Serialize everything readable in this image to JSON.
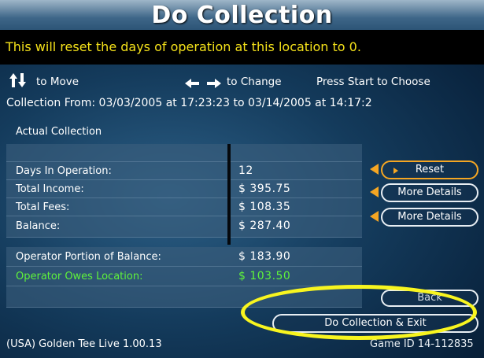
{
  "title": "Do Collection",
  "warning": "This will reset the days of operation at this location to 0.",
  "hints": {
    "move_icon": "up-down-arrows-icon",
    "move": "to Move",
    "change_icon": "left-right-arrows-icon",
    "change": "to Change",
    "choose": "Press Start to Choose"
  },
  "collection_range": "Collection From: 03/03/2005 at 17:23:23 to 03/14/2005 at 14:17:2",
  "section_label": "Actual Collection",
  "rows": [
    {
      "label": "Days In Operation:",
      "value": "12"
    },
    {
      "label": "Total Income:",
      "value": "$ 395.75"
    },
    {
      "label": "Total Fees:",
      "value": "$ 108.35"
    },
    {
      "label": "Balance:",
      "value": "$ 287.40"
    },
    {
      "label": "Operator Portion of Balance:",
      "value": "$ 183.90"
    },
    {
      "label": "Operator Owes Location:",
      "value": "$ 103.50"
    }
  ],
  "buttons": {
    "reset": "Reset",
    "more_details_income": "More Details",
    "more_details_fees": "More Details",
    "back": "Back",
    "do_collection_exit": "Do Collection & Exit"
  },
  "footer": {
    "version": "(USA) Golden Tee Live 1.00.13",
    "game_id": "Game ID 14-112835"
  },
  "colors": {
    "warning_text": "#f5e21a",
    "highlight_row": "#5ff23b",
    "selected_arrow": "#f5a623",
    "annotation_ellipse": "#f8f51f"
  }
}
